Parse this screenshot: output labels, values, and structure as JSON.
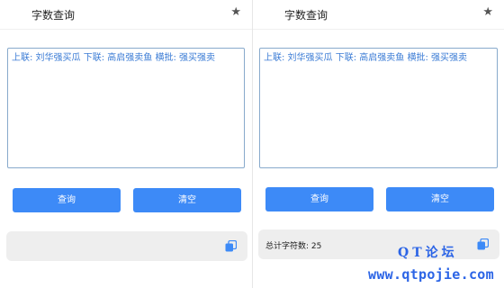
{
  "left": {
    "title": "字数查询",
    "input_value": "上联: 刘华强买瓜 下联: 高启强卖鱼 横批: 强买强卖",
    "query_label": "查询",
    "clear_label": "清空",
    "result_text": ""
  },
  "right": {
    "title": "字数查询",
    "input_value": "上联: 刘华强买瓜 下联: 高启强卖鱼 横批: 强买强卖",
    "query_label": "查询",
    "clear_label": "清空",
    "result_text": "总计字符数: 25"
  },
  "icons": {
    "star": "star-icon",
    "copy": "copy-icon"
  },
  "watermark": {
    "line1": "QT论坛",
    "line2": "www.qtpojie.com"
  },
  "colors": {
    "accent": "#3d8af7",
    "input_text": "#3a7bd5",
    "result_bg": "#eeeeee",
    "watermark": "#2b64e6"
  }
}
